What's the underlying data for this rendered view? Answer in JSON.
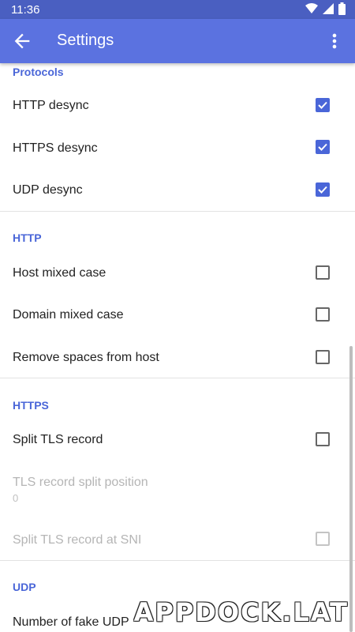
{
  "status_bar": {
    "time": "11:36",
    "icons": [
      "wifi-icon",
      "signal-icon",
      "battery-icon"
    ]
  },
  "app_bar": {
    "title": "Settings",
    "back_icon": "arrow-back-icon",
    "menu_icon": "more-vert-icon"
  },
  "sections": {
    "protocols": {
      "title": "Protocols",
      "items": [
        {
          "label": "HTTP desync",
          "checked": true
        },
        {
          "label": "HTTPS desync",
          "checked": true
        },
        {
          "label": "UDP desync",
          "checked": true
        }
      ]
    },
    "http": {
      "title": "HTTP",
      "items": [
        {
          "label": "Host mixed case",
          "checked": false
        },
        {
          "label": "Domain mixed case",
          "checked": false
        },
        {
          "label": "Remove spaces from host",
          "checked": false
        }
      ]
    },
    "https": {
      "title": "HTTPS",
      "split_tls": {
        "label": "Split TLS record",
        "checked": false
      },
      "split_position": {
        "label": "TLS record split position",
        "summary": "0"
      },
      "split_sni": {
        "label": "Split TLS record at SNI",
        "checked": false
      }
    },
    "udp": {
      "title": "UDP",
      "fake_udp": {
        "label": "Number of fake UDP"
      }
    }
  },
  "watermark": "APPDOCK.LAT",
  "colors": {
    "accent": "#4a66d8",
    "app_bar": "#5b72e0",
    "status_bar": "#4a5fc1"
  }
}
